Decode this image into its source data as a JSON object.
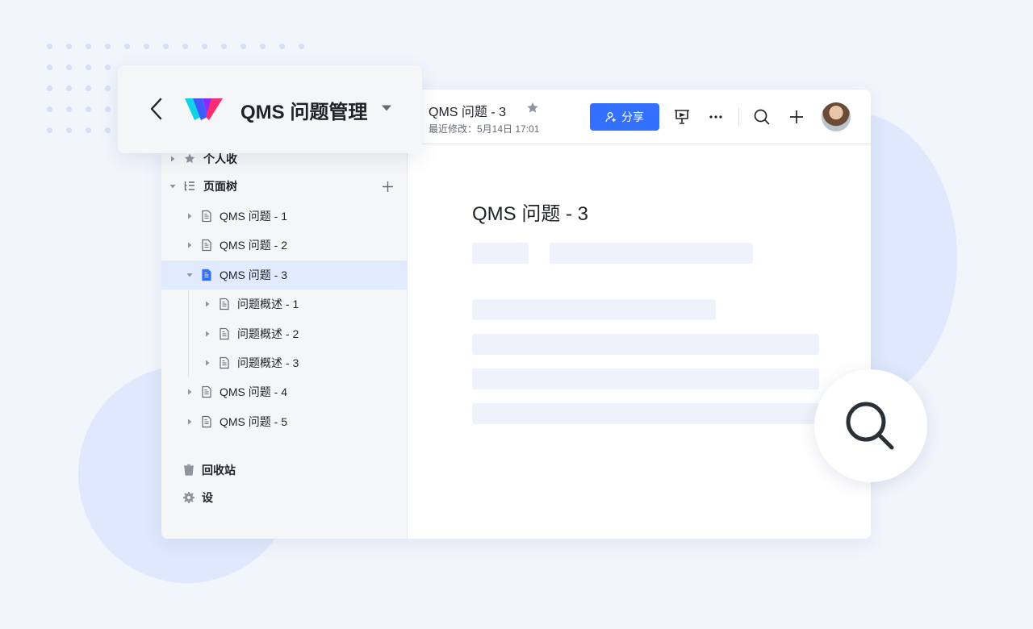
{
  "app": {
    "space_title": "QMS 问题管理"
  },
  "document": {
    "title": "QMS 问题 - 3",
    "last_modified": "最近修改：5月14日 17:01",
    "heading": "QMS 问题 - 3"
  },
  "toolbar": {
    "share_label": "分享"
  },
  "sidebar": {
    "favorites_label": "个人收",
    "page_tree_label": "页面树",
    "items": [
      {
        "label": "QMS 问题 - 1",
        "level": 0,
        "expanded": false,
        "selected": false
      },
      {
        "label": "QMS 问题 - 2",
        "level": 0,
        "expanded": false,
        "selected": false
      },
      {
        "label": "QMS 问题 - 3",
        "level": 0,
        "expanded": true,
        "selected": true
      },
      {
        "label": "问题概述 - 1",
        "level": 1,
        "expanded": false,
        "selected": false
      },
      {
        "label": "问题概述 - 2",
        "level": 1,
        "expanded": false,
        "selected": false
      },
      {
        "label": "问题概述 - 3",
        "level": 1,
        "expanded": false,
        "selected": false
      },
      {
        "label": "QMS 问题 - 4",
        "level": 0,
        "expanded": false,
        "selected": false
      },
      {
        "label": "QMS 问题 - 5",
        "level": 0,
        "expanded": false,
        "selected": false
      }
    ],
    "trash_label": "回收站",
    "settings_label": "设"
  },
  "colors": {
    "accent": "#3370ff",
    "selected_row": "#e1eaff",
    "background": "#f1f5fc"
  }
}
